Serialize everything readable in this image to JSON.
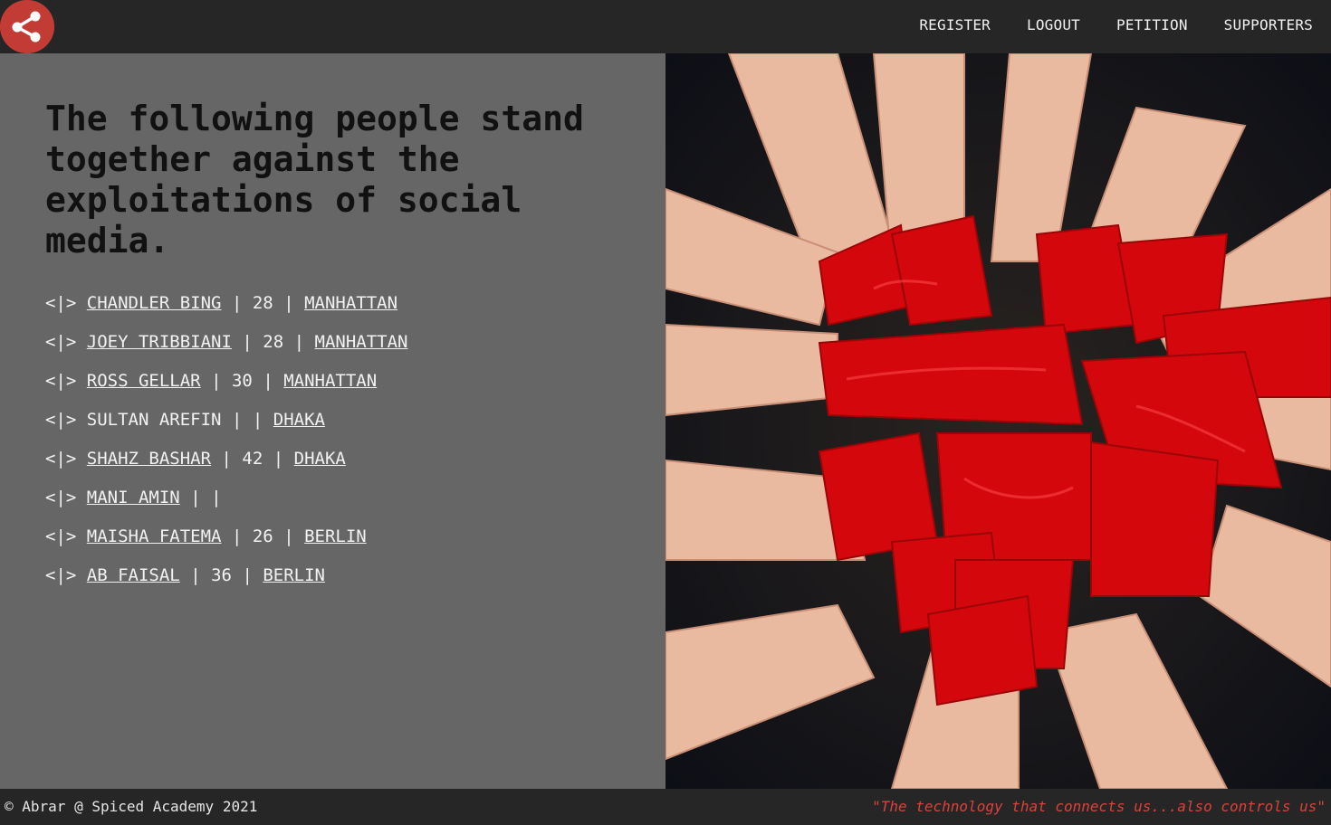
{
  "header": {
    "logo_icon": "share-icon",
    "nav": [
      {
        "label": "REGISTER"
      },
      {
        "label": "LOGOUT"
      },
      {
        "label": "PETITION"
      },
      {
        "label": "SUPPORTERS"
      }
    ]
  },
  "main": {
    "headline": "The following people stand together against the exploitations of social media.",
    "bullet": "<|>",
    "separator": "|",
    "signers": [
      {
        "name": "CHANDLER BING",
        "age": "28",
        "city": "MANHATTAN"
      },
      {
        "name": "JOEY TRIBBIANI",
        "age": "28",
        "city": "MANHATTAN"
      },
      {
        "name": "ROSS GELLAR",
        "age": "30",
        "city": "MANHATTAN"
      },
      {
        "name": "SULTAN AREFIN",
        "age": "",
        "city": "DHAKA"
      },
      {
        "name": "SHAHZ BASHAR",
        "age": "42",
        "city": "DHAKA"
      },
      {
        "name": "MANI AMIN",
        "age": "",
        "city": ""
      },
      {
        "name": "MAISHA FATEMA",
        "age": "26",
        "city": "BERLIN"
      },
      {
        "name": "AB FAISAL",
        "age": "36",
        "city": "BERLIN"
      }
    ]
  },
  "footer": {
    "copyright": "© Abrar @ Spiced Academy 2021",
    "quote": "\"The technology that connects us...also controls us\""
  },
  "colors": {
    "topbar": "#262626",
    "panel": "#666666",
    "accent": "#d9433b",
    "paint": "#d4080c"
  }
}
